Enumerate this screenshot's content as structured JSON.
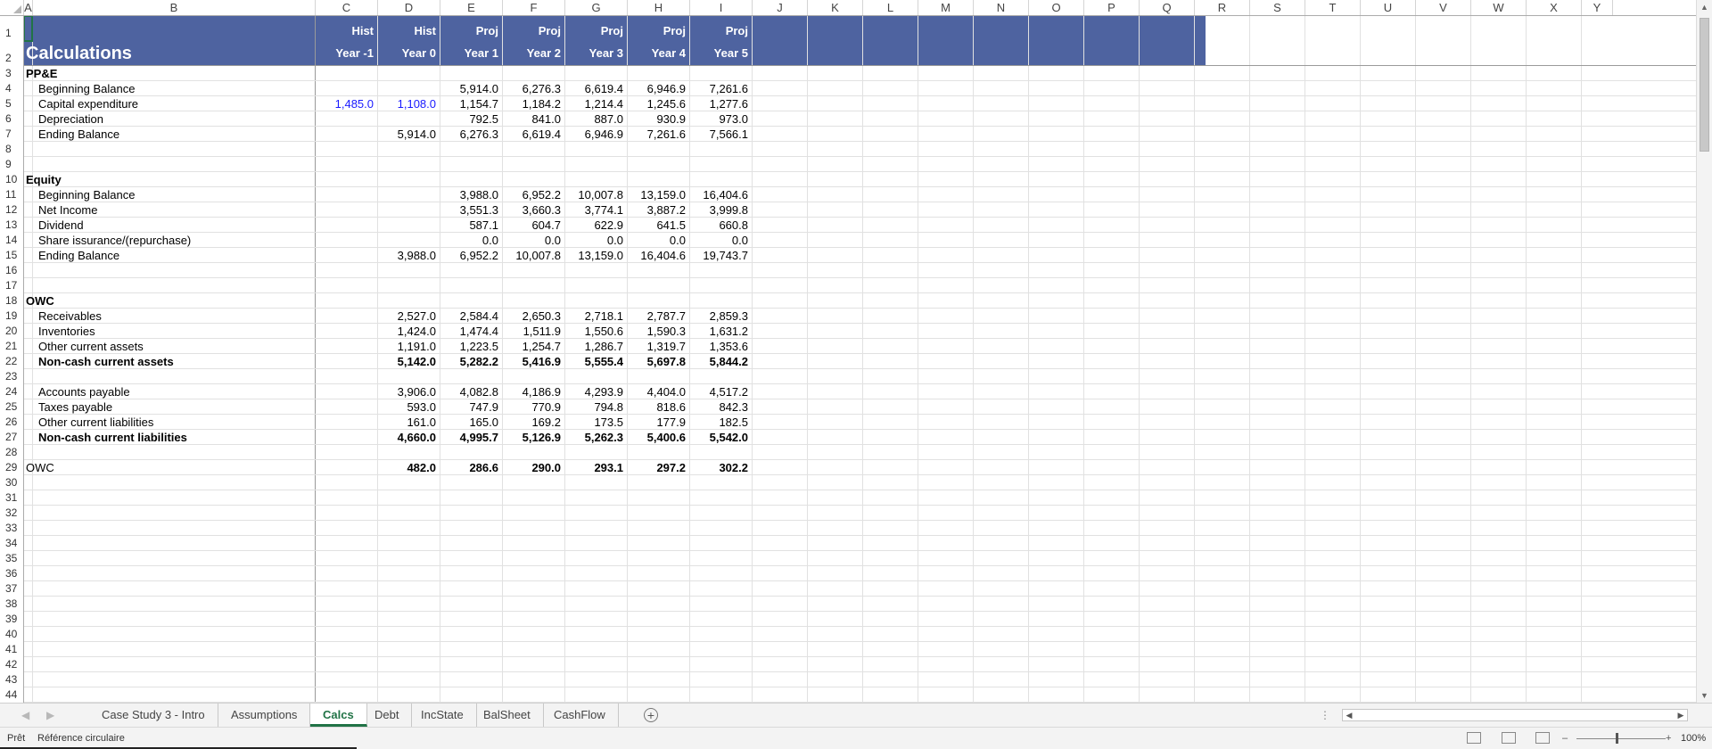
{
  "column_headers": [
    "A",
    "B",
    "C",
    "D",
    "E",
    "F",
    "G",
    "H",
    "I",
    "J",
    "K",
    "L",
    "M",
    "N",
    "O",
    "P",
    "Q",
    "R",
    "S",
    "T",
    "U",
    "V",
    "W",
    "X",
    "Y"
  ],
  "row_numbers": [
    "1",
    "2",
    "3",
    "4",
    "5",
    "6",
    "7",
    "8",
    "9",
    "10",
    "11",
    "12",
    "13",
    "14",
    "15",
    "16",
    "17",
    "18",
    "19",
    "20",
    "21",
    "22",
    "23",
    "24",
    "25",
    "26",
    "27",
    "28",
    "29",
    "30",
    "31",
    "32",
    "33",
    "34",
    "35",
    "36",
    "37",
    "38",
    "39",
    "40",
    "41",
    "42",
    "43",
    "44"
  ],
  "header": {
    "title": "Calculations",
    "row1": [
      "Hist",
      "Hist",
      "Proj",
      "Proj",
      "Proj",
      "Proj",
      "Proj"
    ],
    "row2": [
      "Year -1",
      "Year 0",
      "Year 1",
      "Year 2",
      "Year 3",
      "Year 4",
      "Year 5"
    ]
  },
  "rows": [
    {
      "row": 3,
      "label": "PP&E",
      "indent": false,
      "bold": true,
      "values": [
        "",
        "",
        "",
        "",
        "",
        "",
        ""
      ]
    },
    {
      "row": 4,
      "label": "Beginning Balance",
      "indent": true,
      "bold": false,
      "values": [
        "",
        "",
        "5,914.0",
        "6,276.3",
        "6,619.4",
        "6,946.9",
        "7,261.6"
      ]
    },
    {
      "row": 5,
      "label": "Capital expenditure",
      "indent": true,
      "bold": false,
      "blue_hist": true,
      "values": [
        "1,485.0",
        "1,108.0",
        "1,154.7",
        "1,184.2",
        "1,214.4",
        "1,245.6",
        "1,277.6"
      ]
    },
    {
      "row": 6,
      "label": "Depreciation",
      "indent": true,
      "bold": false,
      "values": [
        "",
        "",
        "792.5",
        "841.0",
        "887.0",
        "930.9",
        "973.0"
      ]
    },
    {
      "row": 7,
      "label": "Ending Balance",
      "indent": true,
      "bold": false,
      "values": [
        "",
        "5,914.0",
        "6,276.3",
        "6,619.4",
        "6,946.9",
        "7,261.6",
        "7,566.1"
      ]
    },
    {
      "row": 10,
      "label": "Equity",
      "indent": false,
      "bold": true,
      "values": [
        "",
        "",
        "",
        "",
        "",
        "",
        ""
      ]
    },
    {
      "row": 11,
      "label": "Beginning Balance",
      "indent": true,
      "bold": false,
      "values": [
        "",
        "",
        "3,988.0",
        "6,952.2",
        "10,007.8",
        "13,159.0",
        "16,404.6"
      ]
    },
    {
      "row": 12,
      "label": "Net Income",
      "indent": true,
      "bold": false,
      "values": [
        "",
        "",
        "3,551.3",
        "3,660.3",
        "3,774.1",
        "3,887.2",
        "3,999.8"
      ]
    },
    {
      "row": 13,
      "label": "Dividend",
      "indent": true,
      "bold": false,
      "values": [
        "",
        "",
        "587.1",
        "604.7",
        "622.9",
        "641.5",
        "660.8"
      ]
    },
    {
      "row": 14,
      "label": "Share issurance/(repurchase)",
      "indent": true,
      "bold": false,
      "values": [
        "",
        "",
        "0.0",
        "0.0",
        "0.0",
        "0.0",
        "0.0"
      ]
    },
    {
      "row": 15,
      "label": "Ending Balance",
      "indent": true,
      "bold": false,
      "values": [
        "",
        "3,988.0",
        "6,952.2",
        "10,007.8",
        "13,159.0",
        "16,404.6",
        "19,743.7"
      ]
    },
    {
      "row": 18,
      "label": "OWC",
      "indent": false,
      "bold": true,
      "values": [
        "",
        "",
        "",
        "",
        "",
        "",
        ""
      ]
    },
    {
      "row": 19,
      "label": "Receivables",
      "indent": true,
      "bold": false,
      "values": [
        "",
        "2,527.0",
        "2,584.4",
        "2,650.3",
        "2,718.1",
        "2,787.7",
        "2,859.3"
      ]
    },
    {
      "row": 20,
      "label": "Inventories",
      "indent": true,
      "bold": false,
      "values": [
        "",
        "1,424.0",
        "1,474.4",
        "1,511.9",
        "1,550.6",
        "1,590.3",
        "1,631.2"
      ]
    },
    {
      "row": 21,
      "label": "Other current assets",
      "indent": true,
      "bold": false,
      "values": [
        "",
        "1,191.0",
        "1,223.5",
        "1,254.7",
        "1,286.7",
        "1,319.7",
        "1,353.6"
      ]
    },
    {
      "row": 22,
      "label": "Non-cash current assets",
      "indent": true,
      "bold": true,
      "values": [
        "",
        "5,142.0",
        "5,282.2",
        "5,416.9",
        "5,555.4",
        "5,697.8",
        "5,844.2"
      ]
    },
    {
      "row": 24,
      "label": "Accounts payable",
      "indent": true,
      "bold": false,
      "values": [
        "",
        "3,906.0",
        "4,082.8",
        "4,186.9",
        "4,293.9",
        "4,404.0",
        "4,517.2"
      ]
    },
    {
      "row": 25,
      "label": "Taxes payable",
      "indent": true,
      "bold": false,
      "values": [
        "",
        "593.0",
        "747.9",
        "770.9",
        "794.8",
        "818.6",
        "842.3"
      ]
    },
    {
      "row": 26,
      "label": "Other current liabilities",
      "indent": true,
      "bold": false,
      "values": [
        "",
        "161.0",
        "165.0",
        "169.2",
        "173.5",
        "177.9",
        "182.5"
      ]
    },
    {
      "row": 27,
      "label": "Non-cash current liabilities",
      "indent": true,
      "bold": true,
      "values": [
        "",
        "4,660.0",
        "4,995.7",
        "5,126.9",
        "5,262.3",
        "5,400.6",
        "5,542.0"
      ]
    },
    {
      "row": 29,
      "label": "OWC",
      "indent": false,
      "bold": false,
      "bold_values": true,
      "values": [
        "",
        "482.0",
        "286.6",
        "290.0",
        "293.1",
        "297.2",
        "302.2"
      ]
    }
  ],
  "sheet_tabs": [
    "Case Study 3 - Intro",
    "Assumptions",
    "Calcs",
    "Debt",
    "IncState",
    "BalSheet",
    "CashFlow"
  ],
  "active_tab": "Calcs",
  "status": {
    "ready": "Prêt",
    "circular": "Référence circulaire",
    "zoom": "100%"
  },
  "colors": {
    "banner": "#4e63a0",
    "accent": "#217346",
    "input_blue": "#1a1aff"
  }
}
